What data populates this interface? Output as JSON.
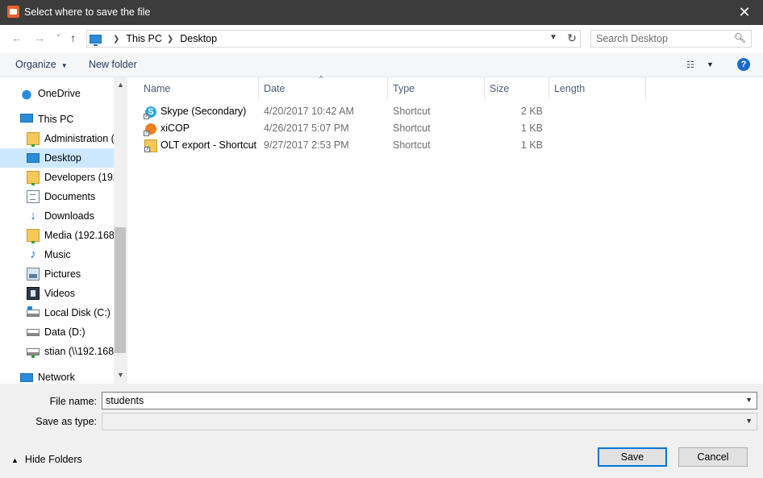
{
  "window": {
    "title": "Select where to save the file",
    "close": "✕"
  },
  "nav": {
    "back": "←",
    "forward": "→",
    "recent": "⌄",
    "up": "↑"
  },
  "address": {
    "crumbs": [
      "This PC",
      "Desktop"
    ],
    "dropdown": "⌄",
    "refresh": "↻"
  },
  "search": {
    "placeholder": "Search Desktop",
    "icon": "⚲"
  },
  "toolbar": {
    "organize": "Organize",
    "new_folder": "New folder",
    "help": "?"
  },
  "sidebar": {
    "items": [
      {
        "label": "OneDrive",
        "icon": "cloud-icon"
      },
      {
        "label": "This PC",
        "icon": "computer-icon"
      },
      {
        "label": "Administration (",
        "icon": "network-folder-icon"
      },
      {
        "label": "Desktop",
        "icon": "desktop-icon",
        "selected": true
      },
      {
        "label": "Developers (192.",
        "icon": "network-folder-icon"
      },
      {
        "label": "Documents",
        "icon": "documents-icon"
      },
      {
        "label": "Downloads",
        "icon": "download-icon"
      },
      {
        "label": "Media (192.168.1",
        "icon": "network-folder-icon"
      },
      {
        "label": "Music",
        "icon": "music-icon"
      },
      {
        "label": "Pictures",
        "icon": "pictures-icon"
      },
      {
        "label": "Videos",
        "icon": "videos-icon"
      },
      {
        "label": "Local Disk (C:)",
        "icon": "local-disk-icon"
      },
      {
        "label": "Data (D:)",
        "icon": "disk-icon"
      },
      {
        "label": "stian (\\\\192.168.1",
        "icon": "network-drive-icon"
      },
      {
        "label": "Network",
        "icon": "network-icon"
      }
    ]
  },
  "filelist": {
    "columns": [
      "Name",
      "Date",
      "Type",
      "Size",
      "Length"
    ],
    "rows": [
      {
        "name": "Skype (Secondary)",
        "date": "4/20/2017 10:42 AM",
        "type": "Shortcut",
        "size": "2 KB",
        "icon": "skype-icon"
      },
      {
        "name": "xiCOP",
        "date": "4/26/2017 5:07 PM",
        "type": "Shortcut",
        "size": "1 KB",
        "icon": "xicop-icon"
      },
      {
        "name": "OLT export - Shortcut",
        "date": "9/27/2017 2:53 PM",
        "type": "Shortcut",
        "size": "1 KB",
        "icon": "folder-shortcut-icon"
      }
    ]
  },
  "form": {
    "file_name_label": "File name:",
    "file_name_value": "students",
    "save_type_label": "Save as type:",
    "save_type_value": ""
  },
  "footer": {
    "hide_folders": "Hide Folders",
    "save": "Save",
    "cancel": "Cancel"
  },
  "colors": {
    "titlebar": "#3c3c3c",
    "selection": "#cce8ff",
    "accent": "#0078d7",
    "link": "#1e395b"
  }
}
